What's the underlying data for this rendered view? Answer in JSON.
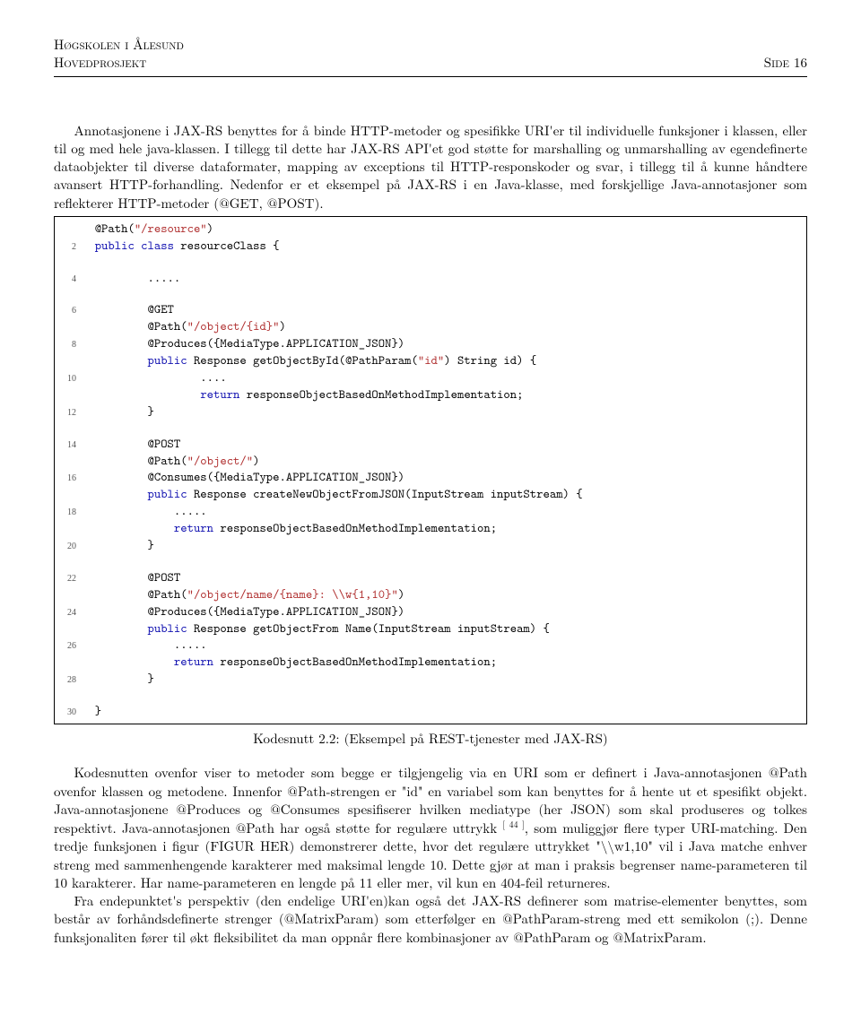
{
  "header": {
    "institution": "Høgskolen i Ålesund",
    "project": "Hovedprosjekt",
    "page_label": "Side 16"
  },
  "para1": "Annotasjonene i JAX-RS benyttes for å binde HTTP-metoder og spesifikke URI'er til individuelle funksjoner i klassen, eller til og med hele java-klassen. I tillegg til dette har JAX-RS API'et god støtte for marshalling og unmarshalling av egendefinerte dataobjekter til diverse dataformater, mapping av exceptions til HTTP-responskoder og svar, i tillegg til å kunne håndtere avansert HTTP-forhandling. Nedenfor er et eksempel på JAX-RS i en Java-klasse, med forskjellige Java-annotasjoner som reflekterer HTTP-metoder (@GET, @POST).",
  "caption": "Kodesnutt 2.2: (Eksempel på REST-tjenester med JAX-RS)",
  "para2_a": "Kodesnutten ovenfor viser to metoder som begge er tilgjengelig via en URI som er definert i Java-annotasjonen @Path ovenfor klassen og metodene. Innenfor @Path-strengen er \"id\" en variabel som kan benyttes for å hente ut et spesifikt objekt. Java-annotasjonene @Produces og @Consumes spesifiserer hvilken mediatype (her JSON) som skal produseres og tolkes respektivt. Java-annotasjonen @Path har også støtte for regulære uttrykk ",
  "cite": "[ 44 ]",
  "para2_b": ", som muliggjør flere typer URI-matching. Den tredje funksjonen i figur (FIGUR HER) demonstrerer dette, hvor det regulære uttrykket \"\\\\w1,10\" vil i Java matche enhver streng med sammenhengende karakterer med maksimal lengde 10. Dette gjør at man i praksis begrenser name-parameteren til 10 karakterer. Har name-parameteren en lengde på 11 eller mer, vil kun en 404-feil returneres.",
  "para3": "Fra endepunktet's perspektiv (den endelige URI'en)kan også det JAX-RS definerer som matrise-elementer benyttes, som består av forhåndsdefinerte strenger (@MatrixParam) som etterfølger en @PathParam-streng med ett semikolon (;). Denne funksjonaliten fører til økt fleksibilitet da man oppnår flere kombinasjoner av @PathParam og @MatrixParam.",
  "code": {
    "l1_a": "  @Path(",
    "l1_s": "\"/resource\"",
    "l1_b": ")",
    "l2_a": "  ",
    "l2_k1": "public",
    "l2_b": " ",
    "l2_k2": "class",
    "l2_c": " resourceClass {",
    "l3": "",
    "l4": "          .....",
    "l5": "",
    "l6": "          @GET",
    "l7_a": "          @Path(",
    "l7_s": "\"/object/{id}\"",
    "l7_b": ")",
    "l8": "          @Produces({MediaType.APPLICATION_JSON})",
    "l9_a": "          ",
    "l9_k": "public",
    "l9_b": " Response getObjectById(@PathParam(",
    "l9_s": "\"id\"",
    "l9_c": ") String id) {",
    "l10": "                  ....",
    "l11_a": "                  ",
    "l11_k": "return",
    "l11_b": " responseObjectBasedOnMethodImplementation;",
    "l12": "          }",
    "l13": "",
    "l14": "          @POST",
    "l15_a": "          @Path(",
    "l15_s": "\"/object/\"",
    "l15_b": ")",
    "l16": "          @Consumes({MediaType.APPLICATION_JSON})",
    "l17_a": "          ",
    "l17_k": "public",
    "l17_b": " Response createNewObjectFromJSON(InputStream inputStream) {",
    "l18": "              .....",
    "l19_a": "              ",
    "l19_k": "return",
    "l19_b": " responseObjectBasedOnMethodImplementation;",
    "l20": "          }",
    "l21": "",
    "l22": "          @POST",
    "l23_a": "          @Path(",
    "l23_s": "\"/object/name/{name}: \\\\w{1,10}\"",
    "l23_b": ")",
    "l24": "          @Produces({MediaType.APPLICATION_JSON})",
    "l25_a": "          ",
    "l25_k": "public",
    "l25_b": " Response getObjectFrom Name(InputStream inputStream) {",
    "l26": "              .....",
    "l27_a": "              ",
    "l27_k": "return",
    "l27_b": " responseObjectBasedOnMethodImplementation;",
    "l28": "          }",
    "l29": "",
    "l30": "  }",
    "ln2": "2",
    "ln4": "4",
    "ln6": "6",
    "ln8": "8",
    "ln10": "10",
    "ln12": "12",
    "ln14": "14",
    "ln16": "16",
    "ln18": "18",
    "ln20": "20",
    "ln22": "22",
    "ln24": "24",
    "ln26": "26",
    "ln28": "28",
    "ln30": "30"
  }
}
